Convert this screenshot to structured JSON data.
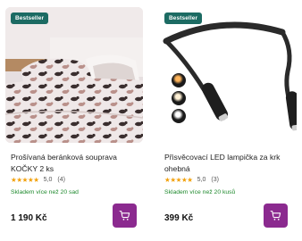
{
  "products": [
    {
      "badge": "Bestseller",
      "title": "Prošívaná beránková souprava KOČKY 2 ks",
      "stars": "★★★★★",
      "rating": "5,0",
      "reviews": "(4)",
      "stock": "Skladem více než 20 sad",
      "price": "1 190 Kč",
      "image_icon": "bedding-cats-photo"
    },
    {
      "badge": "Bestseller",
      "title": "Přisvěcovací LED lampička za krk ohebná",
      "stars": "★★★★★",
      "rating": "5,0",
      "reviews": "(3)",
      "stock": "Skladem více než 20 kusů",
      "price": "399 Kč",
      "image_icon": "neck-led-lamp-photo"
    }
  ],
  "colors": {
    "badge": "#1c6b63",
    "cart_button": "#8b2a8f",
    "stock": "#1f8a2e",
    "stars": "#f2a10c"
  },
  "icons": {
    "cart": "cart-icon"
  }
}
